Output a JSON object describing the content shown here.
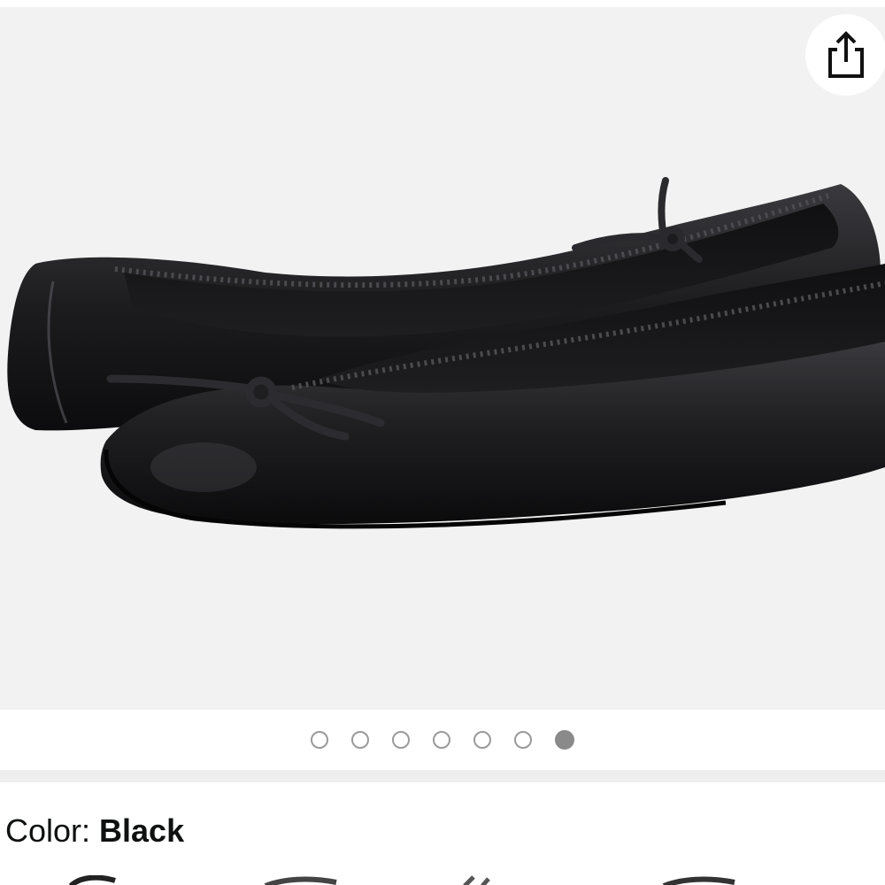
{
  "carousel": {
    "total_images": 7,
    "active_index": 6
  },
  "share": {
    "icon": "share-icon"
  },
  "selection": {
    "color_label": "Color: ",
    "color_value": "Black"
  },
  "colors": {
    "image_bg": "#f2f2f2",
    "dot_inactive": "#9a9a9a",
    "dot_active": "#8a8a8a"
  }
}
